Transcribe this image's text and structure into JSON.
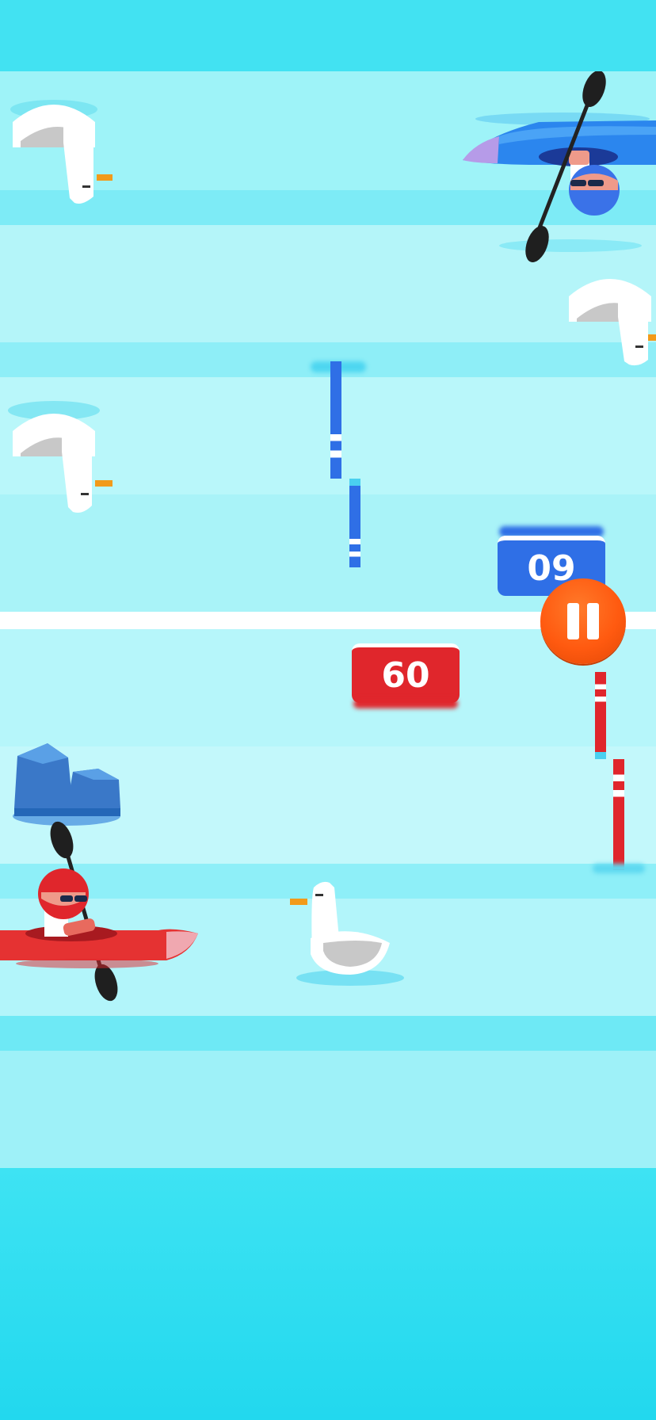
{
  "game": {
    "opponent_score": "09",
    "player_score": "60"
  },
  "controls": {
    "pause_icon": "pause-icon"
  },
  "colors": {
    "water_deep": "#3fe3f3",
    "water_light": "#b7f7fa",
    "player_red": "#e0262c",
    "opponent_blue": "#2f6fe6",
    "pause_orange": "#ff5a10"
  }
}
